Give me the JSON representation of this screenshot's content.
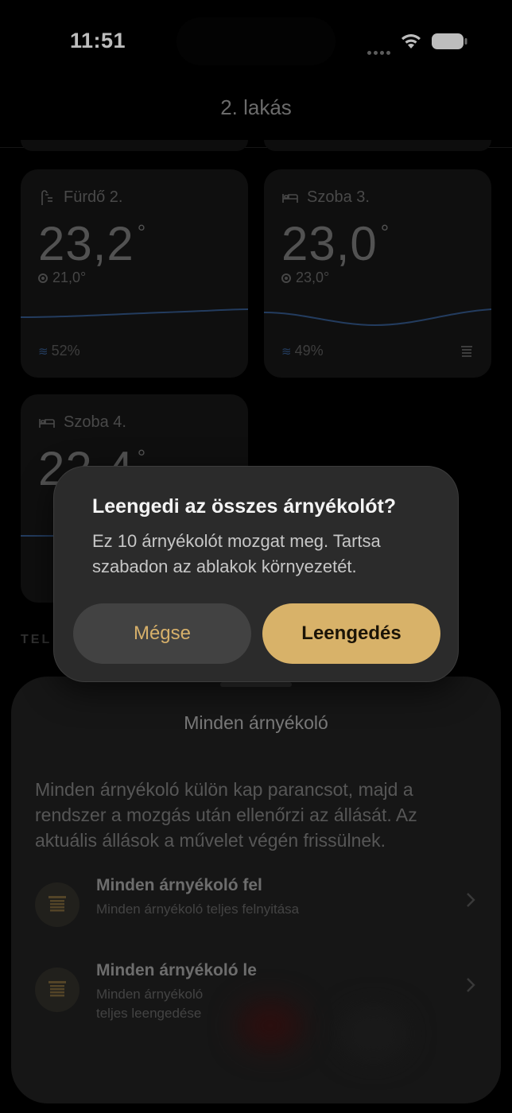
{
  "status_bar": {
    "time": "11:51"
  },
  "nav": {
    "title": "2. lakás"
  },
  "rooms": [
    {
      "name": "Fürdő 2.",
      "icon": "bath-icon",
      "temp": "23,2",
      "setpoint": "21,0°",
      "humidity": "52%",
      "has_blind": false
    },
    {
      "name": "Szoba 3.",
      "icon": "bed-icon",
      "temp": "23,0",
      "setpoint": "23,0°",
      "humidity": "49%",
      "has_blind": true
    },
    {
      "name": "Szoba 4.",
      "icon": "bed-icon",
      "temp": "22,4",
      "setpoint": "",
      "humidity": "",
      "has_blind": false
    }
  ],
  "section": {
    "label": "TEL"
  },
  "sheet": {
    "title": "Minden árnyékoló",
    "description": "Minden árnyékoló külön kap parancsot, majd a rendszer a mozgás után ellenőrzi az állását. Az aktuális állások a művelet végén frissülnek.",
    "actions": [
      {
        "title": "Minden árnyékoló fel",
        "subtitle": "Minden árnyékoló teljes felnyitása"
      },
      {
        "title": "Minden árnyékoló le",
        "subtitle_line1": "Minden árnyékoló",
        "subtitle_line2": "teljes leengedése"
      }
    ]
  },
  "alert": {
    "title": "Leengedi az összes árnyékolót?",
    "message": "Ez 10 árnyékolót mozgat meg. Tartsa szabadon az ablakok környezetét.",
    "cancel_label": "Mégse",
    "confirm_label": "Leengedés"
  },
  "colors": {
    "accent": "#d8b269",
    "background": "#000000",
    "card": "#141414",
    "alert": "#2b2b2b",
    "curve": "#2e4e7a"
  }
}
